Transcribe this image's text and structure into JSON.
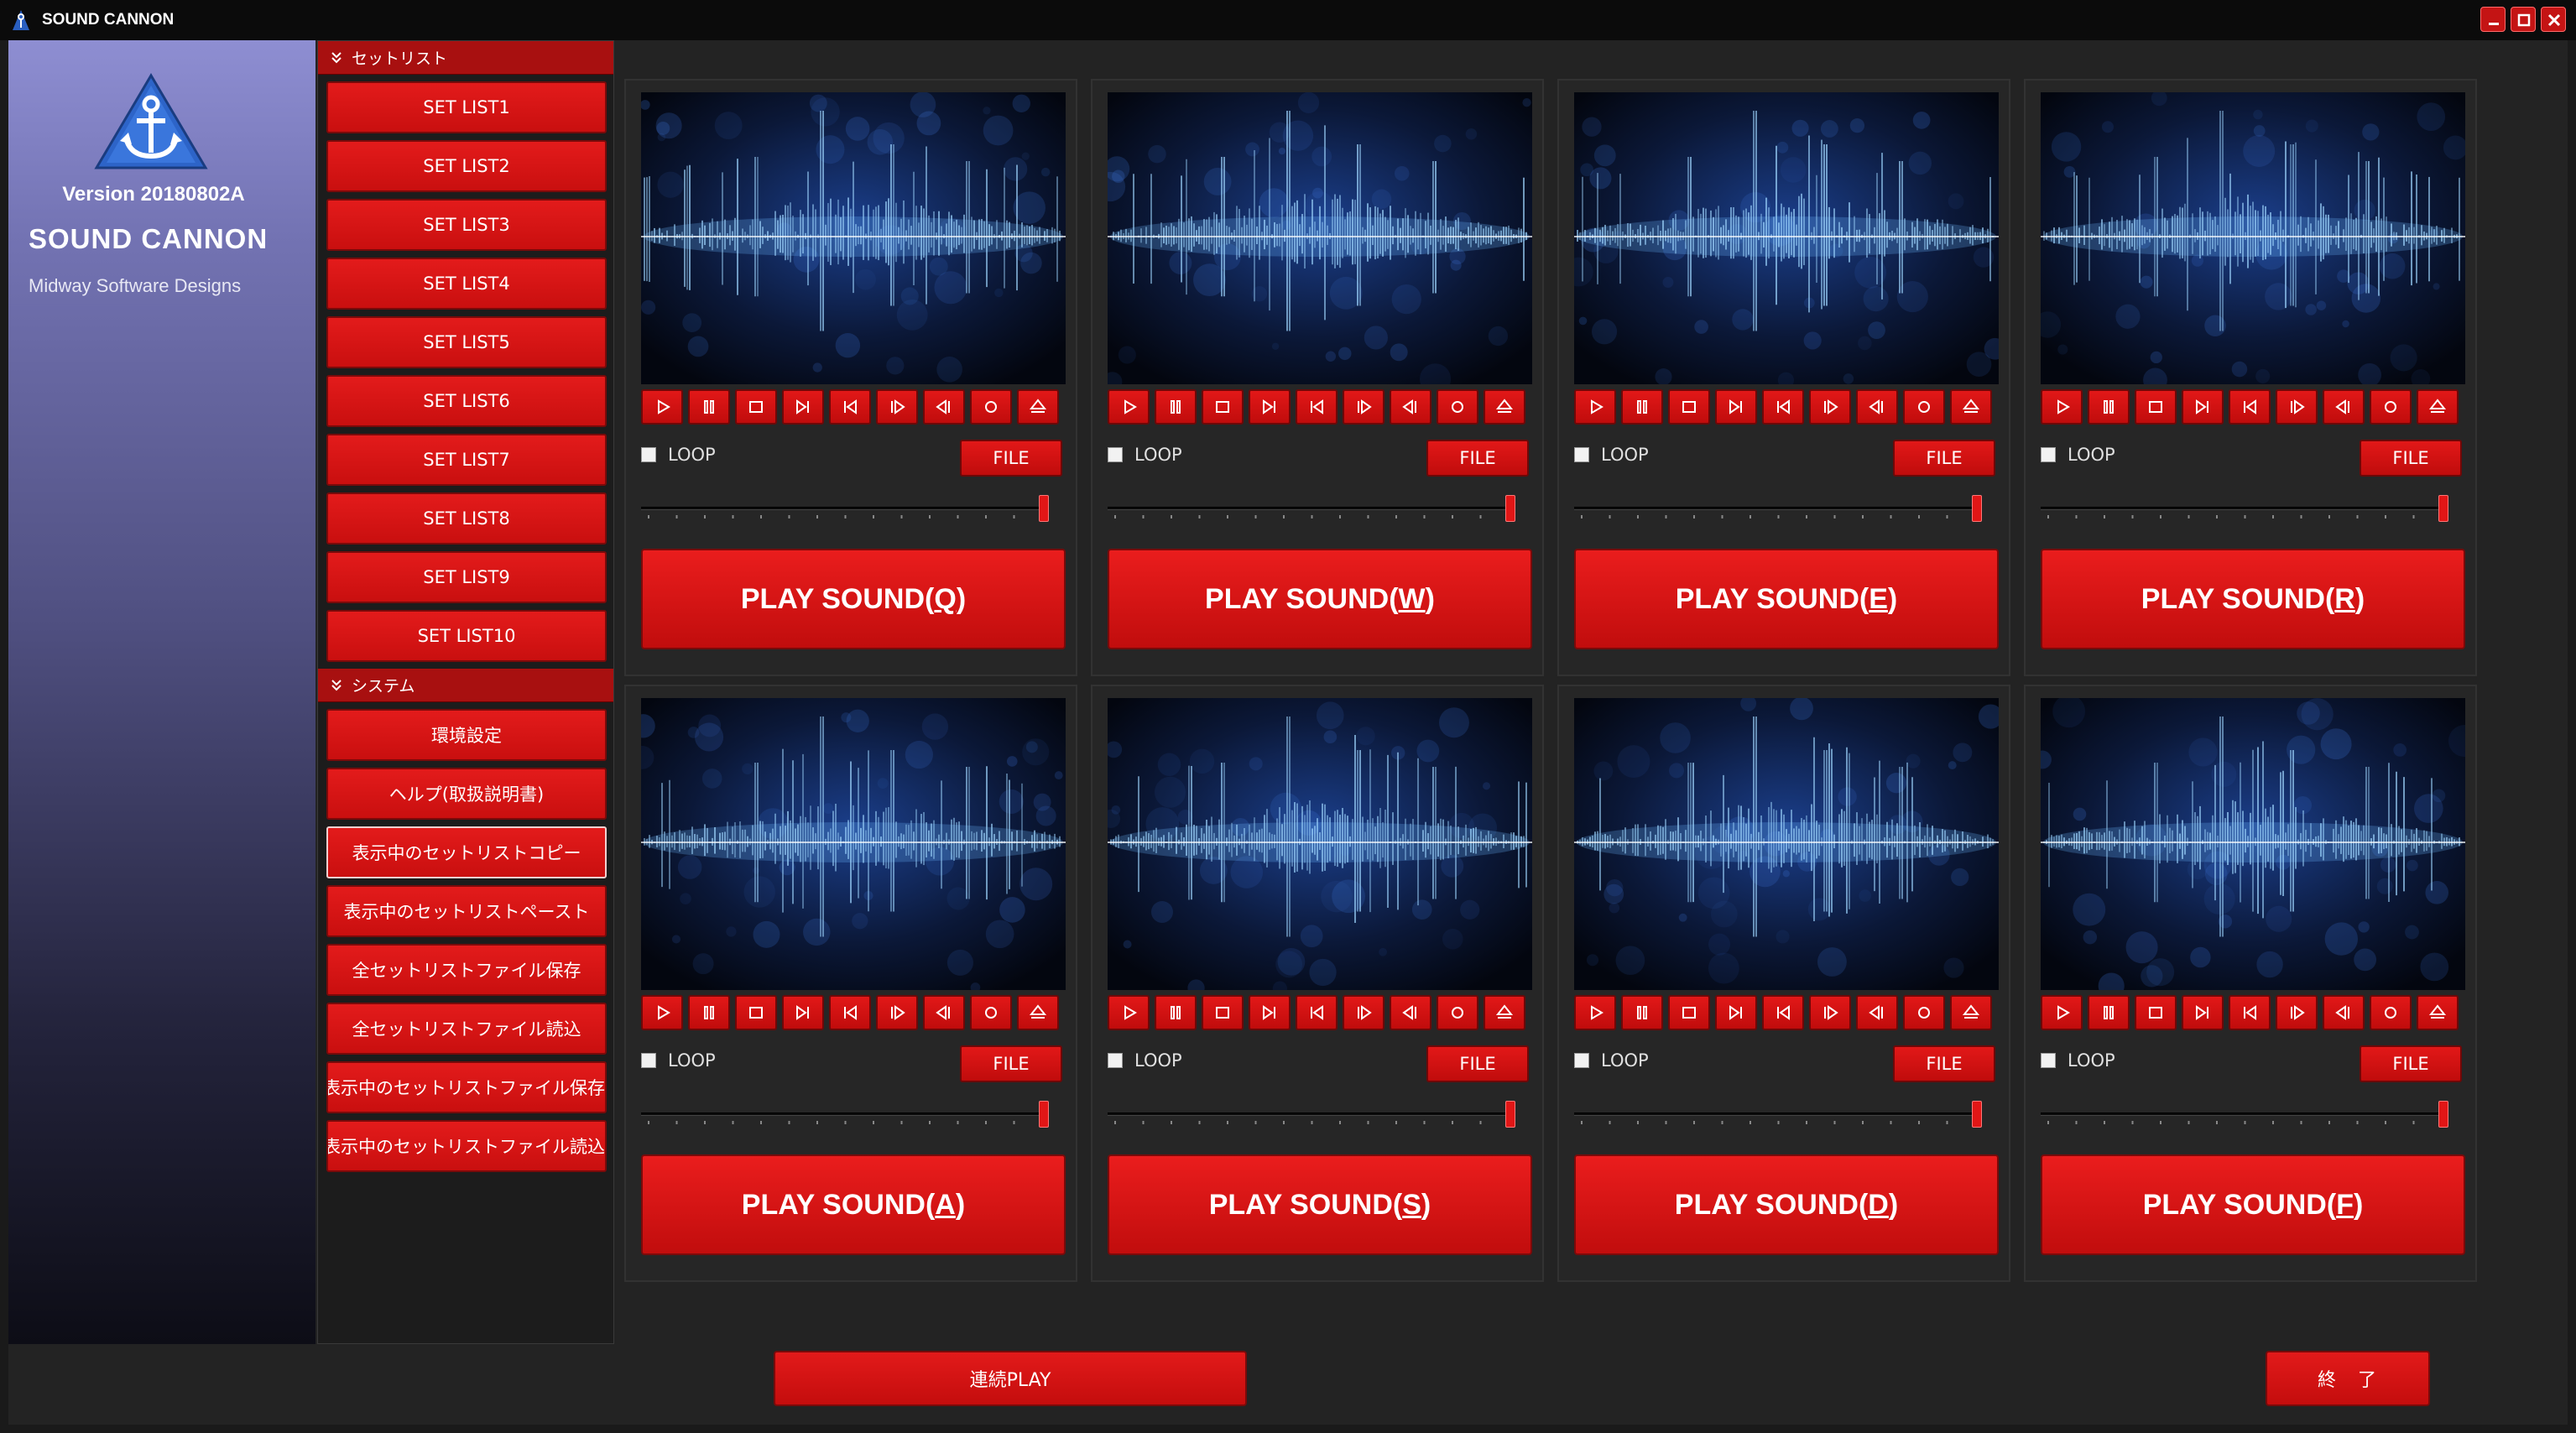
{
  "window": {
    "title": "SOUND CANNON"
  },
  "brand": {
    "version": "Version 20180802A",
    "name": "SOUND CANNON",
    "company": "Midway Software Designs"
  },
  "menu": {
    "setlist_header": "セットリスト",
    "setlists": [
      "SET LIST1",
      "SET LIST2",
      "SET LIST3",
      "SET LIST4",
      "SET LIST5",
      "SET LIST6",
      "SET LIST7",
      "SET LIST8",
      "SET LIST9",
      "SET LIST10"
    ],
    "system_header": "システム",
    "system_items": [
      "環境設定",
      "ヘルプ(取扱説明書)",
      "表示中のセットリストコピー",
      "表示中のセットリストペースト",
      "全セットリストファイル保存",
      "全セットリストファイル読込",
      "表示中のセットリストファイル保存",
      "表示中のセットリストファイル読込"
    ]
  },
  "pads": [
    {
      "prefix": "PLAY SOUND(",
      "key": "Q",
      "suffix": ")",
      "loop_label": "LOOP",
      "file_label": "FILE",
      "loop_checked": false,
      "volume": 1.0
    },
    {
      "prefix": "PLAY SOUND(",
      "key": "W",
      "suffix": ")",
      "loop_label": "LOOP",
      "file_label": "FILE",
      "loop_checked": false,
      "volume": 1.0
    },
    {
      "prefix": "PLAY SOUND(",
      "key": "E",
      "suffix": ")",
      "loop_label": "LOOP",
      "file_label": "FILE",
      "loop_checked": false,
      "volume": 1.0
    },
    {
      "prefix": "PLAY SOUND(",
      "key": "R",
      "suffix": ")",
      "loop_label": "LOOP",
      "file_label": "FILE",
      "loop_checked": false,
      "volume": 1.0
    },
    {
      "prefix": "PLAY SOUND(",
      "key": "A",
      "suffix": ")",
      "loop_label": "LOOP",
      "file_label": "FILE",
      "loop_checked": false,
      "volume": 1.0
    },
    {
      "prefix": "PLAY SOUND(",
      "key": "S",
      "suffix": ")",
      "loop_label": "LOOP",
      "file_label": "FILE",
      "loop_checked": false,
      "volume": 1.0
    },
    {
      "prefix": "PLAY SOUND(",
      "key": "D",
      "suffix": ")",
      "loop_label": "LOOP",
      "file_label": "FILE",
      "loop_checked": false,
      "volume": 1.0
    },
    {
      "prefix": "PLAY SOUND(",
      "key": "F",
      "suffix": ")",
      "loop_label": "LOOP",
      "file_label": "FILE",
      "loop_checked": false,
      "volume": 1.0
    }
  ],
  "transport_icons": [
    "play-icon",
    "pause-icon",
    "stop-icon",
    "skip-end-icon",
    "skip-start-icon",
    "step-forward-icon",
    "step-back-icon",
    "record-icon",
    "eject-icon"
  ],
  "footer": {
    "continuous_play": "連続PLAY",
    "quit": "終　了"
  },
  "colors": {
    "accent": "#d01212",
    "background": "#232323"
  }
}
